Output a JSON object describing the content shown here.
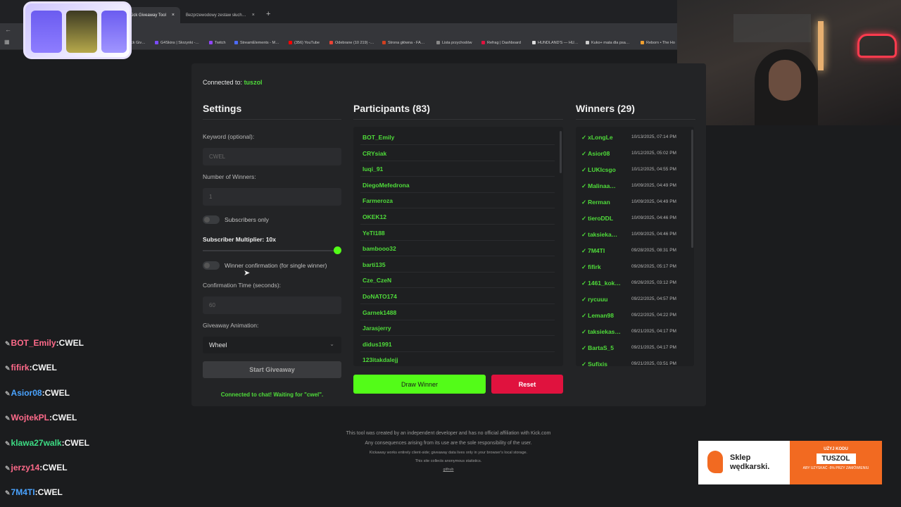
{
  "browser": {
    "tabs": [
      {
        "label": "Kick Giveaway Tool",
        "active": true
      },
      {
        "label": "Bezprzewodowy zestaw słuch…",
        "active": false
      }
    ],
    "new_tab": "+",
    "bookmarks": [
      "ck Giv…",
      "G4Skins | Skrzynki -…",
      "Twitch",
      "StreamElements - M…",
      "(356) YouTube",
      "Odebrane (10 219) -…",
      "Strona główna - FA…",
      "Lista przychodów",
      "Refrag | Dashboard",
      "HUNDLAND'S — HU…",
      "Kuko+ mata dla psa…",
      "Reborn • The Ho"
    ]
  },
  "app": {
    "connected_prefix": "Connected to:",
    "channel": "tuszol",
    "settings": {
      "title": "Settings",
      "keyword_label": "Keyword (optional):",
      "keyword_placeholder": "CWEL",
      "winners_label": "Number of Winners:",
      "winners_value": "1",
      "subscribers_only": "Subscribers only",
      "multiplier_label": "Subscriber Multiplier: 10x",
      "multiplier_value": 1.0,
      "winner_confirmation": "Winner confirmation (for single winner)",
      "confirmation_label": "Confirmation Time (seconds):",
      "confirmation_placeholder": "60",
      "animation_label": "Giveaway Animation:",
      "animation_value": "Wheel",
      "start_button": "Start Giveaway",
      "status": "Connected to chat! Waiting for \"cwel\"."
    },
    "participants": {
      "title": "Participants (83)",
      "items": [
        "BOT_Emily",
        "CRYsiak",
        "luqi_91",
        "DiegoMefedrona",
        "Farmeroza",
        "OKEK12",
        "YeTI188",
        "bambooo32",
        "barti135",
        "Cze_CzeN",
        "DoNATO174",
        "Garnek1488",
        "Jarasjerry",
        "didus1991",
        "123itakdalejj"
      ]
    },
    "winners": {
      "title": "Winners (29)",
      "items": [
        {
          "name": "xLongLe",
          "time": "10/13/2025, 07:14 PM"
        },
        {
          "name": "Asior08",
          "time": "10/12/2025, 05:02 PM"
        },
        {
          "name": "LUKIcsgo",
          "time": "10/12/2025, 04:55 PM"
        },
        {
          "name": "Malinaa…",
          "time": "10/09/2025, 04:49 PM"
        },
        {
          "name": "Rerman",
          "time": "10/09/2025, 04:49 PM"
        },
        {
          "name": "tieroDDL",
          "time": "10/09/2025, 04:46 PM"
        },
        {
          "name": "taksieka…",
          "time": "10/09/2025, 04:46 PM"
        },
        {
          "name": "7M4TI",
          "time": "09/28/2025, 08:31 PM"
        },
        {
          "name": "fifirk",
          "time": "09/26/2025, 05:17 PM"
        },
        {
          "name": "1461_kok…",
          "time": "09/26/2025, 03:12 PM"
        },
        {
          "name": "rycuuu",
          "time": "09/22/2025, 04:57 PM"
        },
        {
          "name": "Leman98",
          "time": "09/22/2025, 04:22 PM"
        },
        {
          "name": "taksiekas…",
          "time": "09/21/2025, 04:17 PM"
        },
        {
          "name": "BartaS_5",
          "time": "09/21/2025, 04:17 PM"
        },
        {
          "name": "Sufixis",
          "time": "09/21/2025, 03:51 PM"
        }
      ]
    },
    "draw_button": "Draw Winner",
    "reset_button": "Reset",
    "footer": [
      "This tool was created by an independent developer and has no official affiliation with Kick.com",
      "Any consequences arising from its use are the sole responsibility of the user.",
      "Kickaway works entirely client-side; giveaway data lives only in your browser's local storage.",
      "This site collects anonymous statistics.",
      "github"
    ]
  },
  "chat": [
    {
      "user": "BOT_Emily",
      "msg": "CWEL",
      "color": "#ff6a8a"
    },
    {
      "user": "fifirk",
      "msg": "CWEL",
      "color": "#ff6a8a"
    },
    {
      "user": "Asior08",
      "msg": "CWEL",
      "color": "#4aa3ff"
    },
    {
      "user": "WojtekPL",
      "msg": "CWEL",
      "color": "#ff6a8a"
    },
    {
      "user": "klawa27walk",
      "msg": "CWEL",
      "color": "#3ddc84"
    },
    {
      "user": "jerzy14",
      "msg": "CWEL",
      "color": "#ff6a8a"
    },
    {
      "user": "7M4TI",
      "msg": "CWEL",
      "color": "#4aa3ff"
    }
  ],
  "sponsor": {
    "shop_line1": "Sklep",
    "shop_line2": "wędkarski.",
    "promo_top": "UŻYJ KODU",
    "code": "TUSZOL",
    "promo_bottom": "ABY UZYSKAĆ -5% PRZY ZAMÓWIENIU"
  },
  "colors": {
    "accent": "#53fc18",
    "accent_text": "#4fdc3a",
    "danger": "#e0123e",
    "card": "#232426",
    "page": "#1b1c1e"
  }
}
